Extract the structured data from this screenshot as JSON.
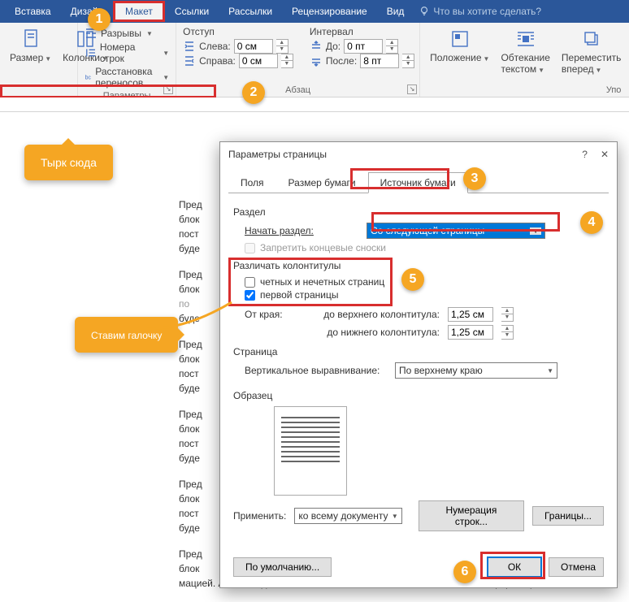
{
  "tabs": {
    "insert": "Вставка",
    "design": "Дизайн",
    "layout": "Макет",
    "references": "Ссылки",
    "mailings": "Рассылки",
    "review": "Рецензирование",
    "view": "Вид",
    "tellme": "Что вы хотите сделать?"
  },
  "ribbon": {
    "size": "Размер",
    "columns": "Колонки",
    "breaks": "Разрывы",
    "line_numbers": "Номера строк",
    "hyphenation": "Расстановка переносов",
    "group_page": "Параметры страницы",
    "indent_title": "Отступ",
    "left": "Слева:",
    "right": "Справа:",
    "left_val": "0 см",
    "right_val": "0 см",
    "spacing_title": "Интервал",
    "before": "До:",
    "after": "После:",
    "before_val": "0 пт",
    "after_val": "8 пт",
    "group_para": "Абзац",
    "position": "Положение",
    "wrap": "Обтекание текстом",
    "forward": "Переместить вперед",
    "group_arrange": "Упо"
  },
  "callouts": {
    "c1": "1",
    "c2": "2",
    "c3": "3",
    "c4": "4",
    "c5": "5",
    "c6": "6",
    "t1": "Тырк сюда",
    "t2": "Ставим галочку"
  },
  "doc": {
    "p": "Пред",
    "b": "блок",
    "po": "пост",
    "bu": "буде",
    "long": "мацией. А сейчас для более полного заполнения блока текстовой инфор мацией"
  },
  "dialog": {
    "title": "Параметры страницы",
    "help": "?",
    "close": "✕",
    "tab_margins": "Поля",
    "tab_paper": "Размер бумаги",
    "tab_layout": "Источник бумаги",
    "section": "Раздел",
    "section_start": "Начать раздел:",
    "section_start_val": "Со следующей страницы",
    "suppress": "Запретить концевые сноски",
    "headers": "Различать колонтитулы",
    "odd_even": "четных и нечетных страниц",
    "first_page": "первой страницы",
    "from_edge": "От края:",
    "header_dist": "до верхнего колонтитула:",
    "footer_dist": "до нижнего колонтитула:",
    "dist_val": "1,25 см",
    "page": "Страница",
    "valign": "Вертикальное выравнивание:",
    "valign_val": "По верхнему краю",
    "preview": "Образец",
    "apply": "Применить:",
    "apply_val": "ко всему документу",
    "line_nums": "Нумерация строк...",
    "borders": "Границы...",
    "default": "По умолчанию...",
    "ok": "ОК",
    "cancel": "Отмена"
  }
}
